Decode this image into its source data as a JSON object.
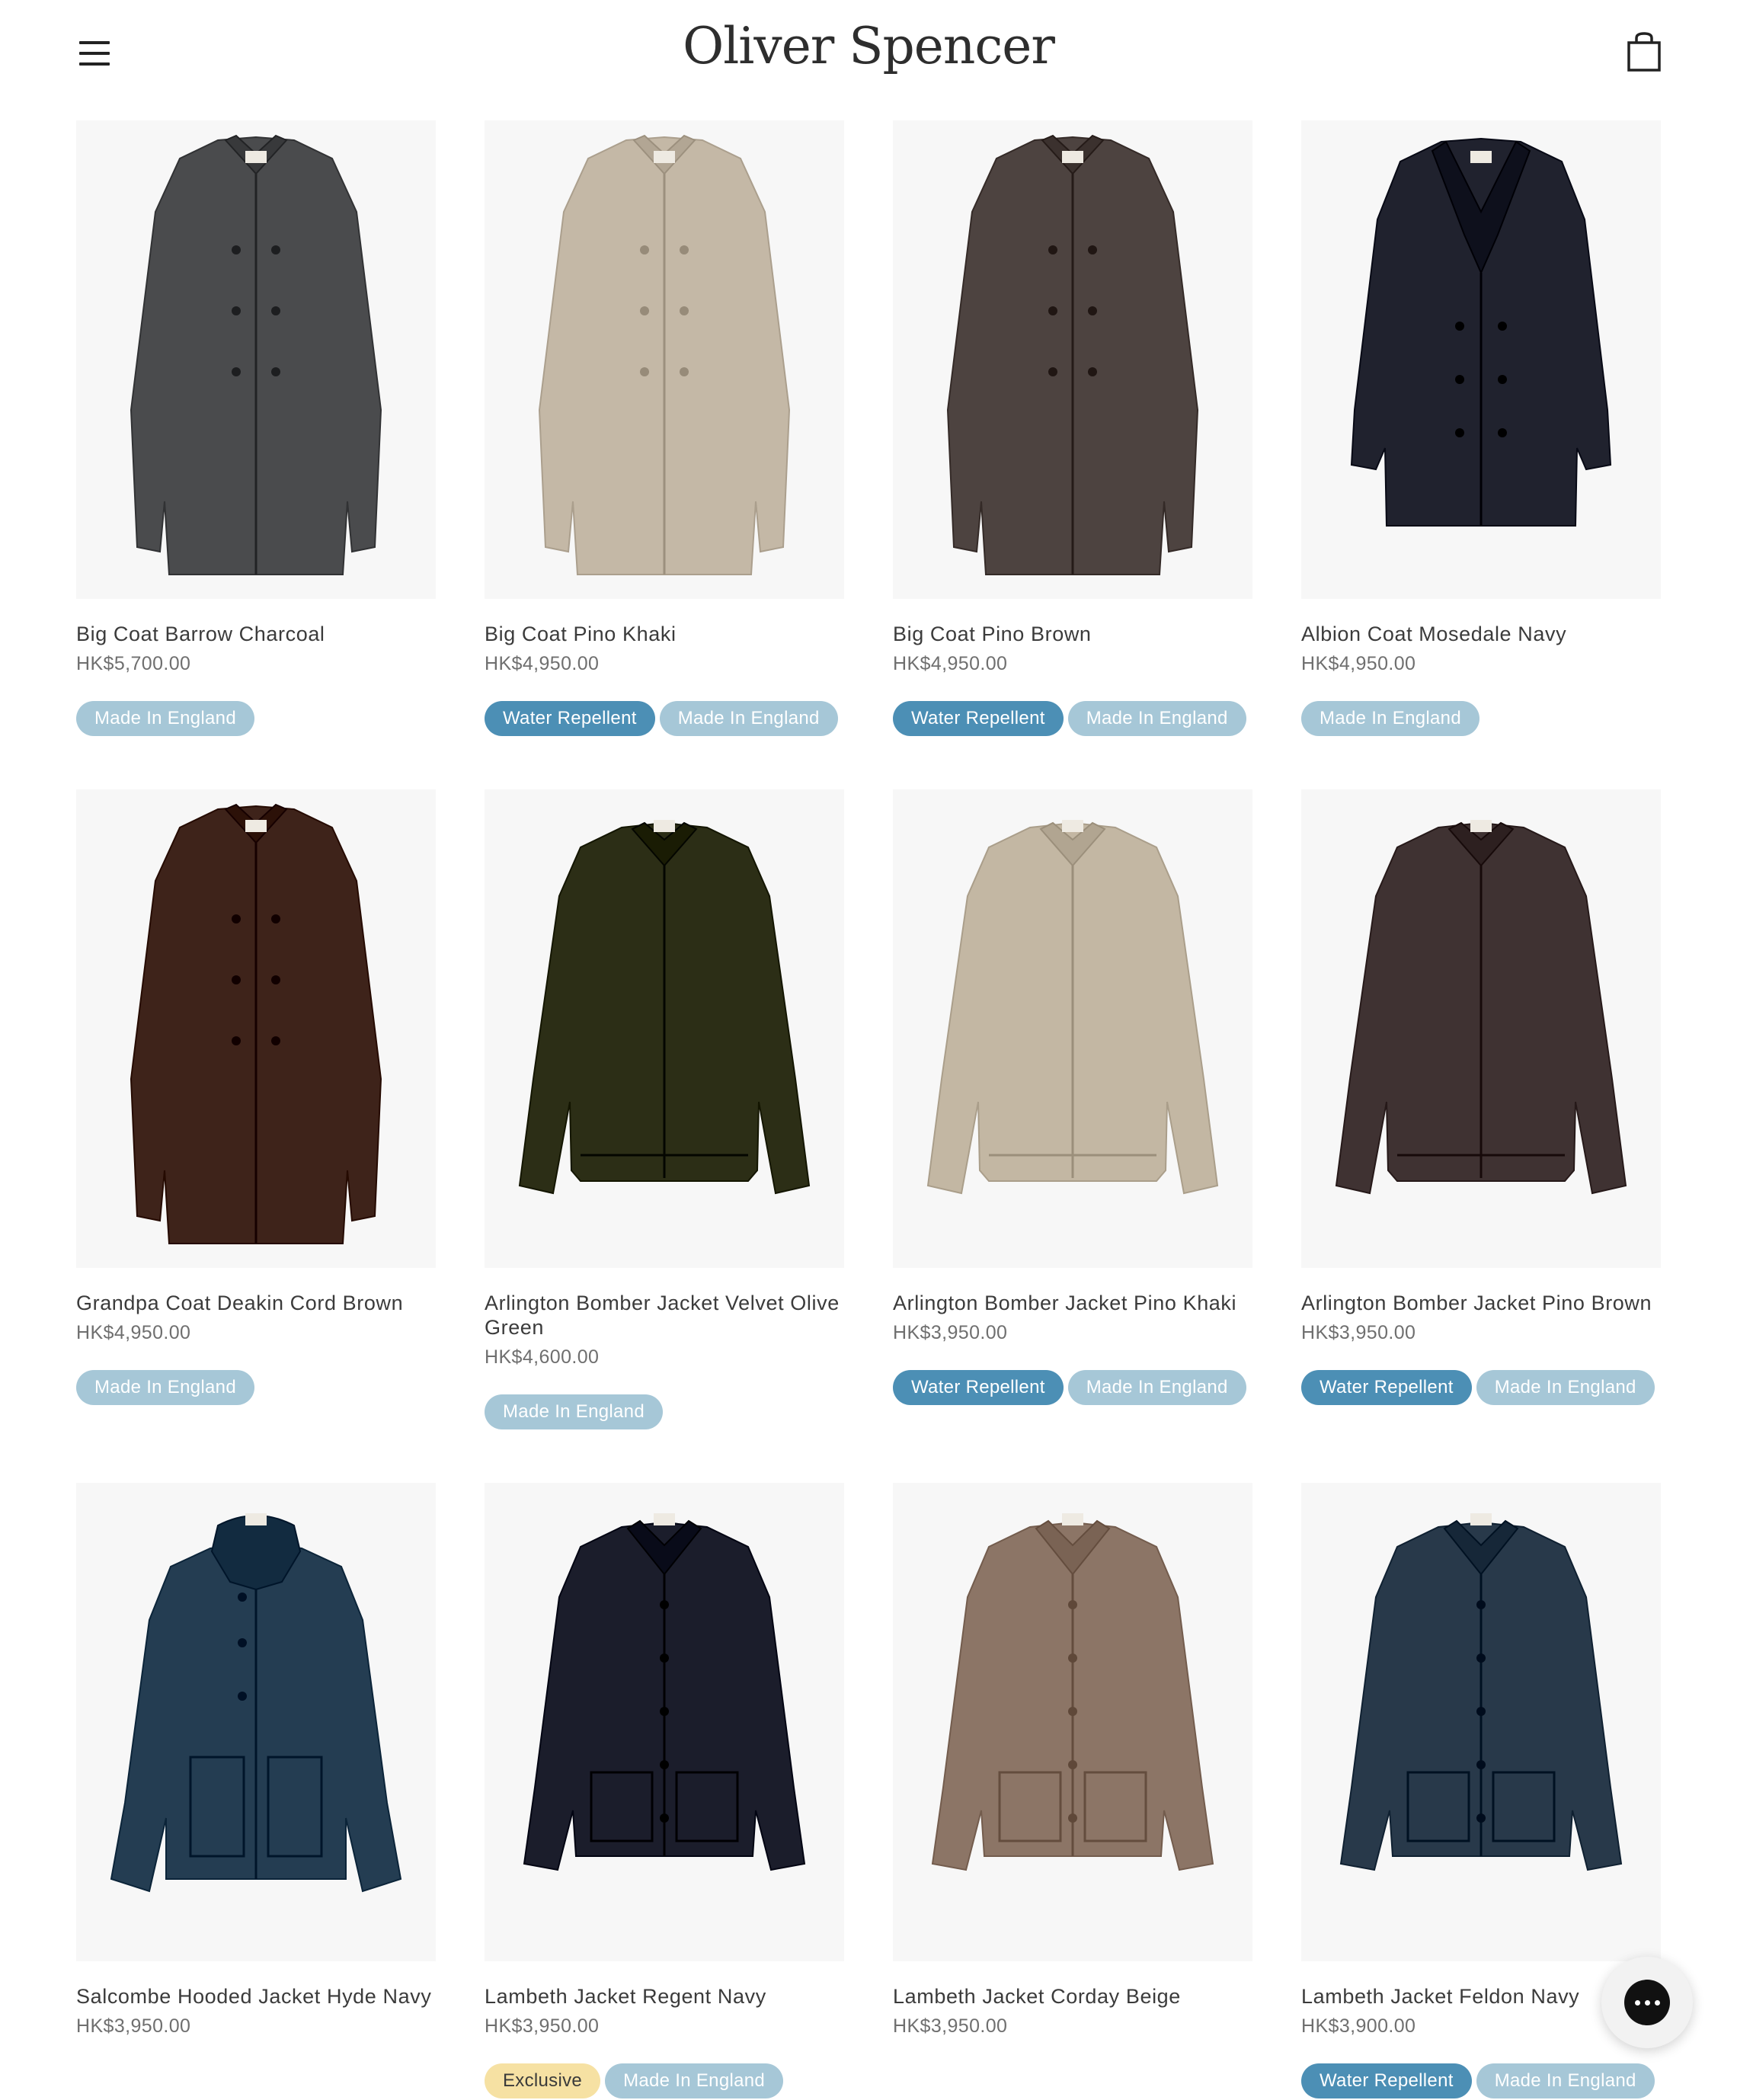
{
  "header": {
    "brand": "Oliver Spencer",
    "menu_icon": "hamburger-menu-icon",
    "cart_icon": "shopping-bag-icon"
  },
  "colors": {
    "water_badge": "#4c8fb5",
    "made_badge": "#a6c7d7",
    "exclusive_badge": "#f6e1a3",
    "image_bg": "#f7f7f7"
  },
  "products": [
    {
      "title": "Big Coat Barrow Charcoal",
      "price": "HK$5,700.00",
      "badges": [
        {
          "label": "Made In England",
          "kind": "made"
        }
      ],
      "garment": "long-coat",
      "color": "#4a4b4d"
    },
    {
      "title": "Big Coat Pino Khaki",
      "price": "HK$4,950.00",
      "badges": [
        {
          "label": "Water Repellent",
          "kind": "water"
        },
        {
          "label": "Made In England",
          "kind": "made"
        }
      ],
      "garment": "long-coat",
      "color": "#c4b8a6"
    },
    {
      "title": "Big Coat Pino Brown",
      "price": "HK$4,950.00",
      "badges": [
        {
          "label": "Water Repellent",
          "kind": "water"
        },
        {
          "label": "Made In England",
          "kind": "made"
        }
      ],
      "garment": "long-coat",
      "color": "#4d4340"
    },
    {
      "title": "Albion Coat Mosedale Navy",
      "price": "HK$4,950.00",
      "badges": [
        {
          "label": "Made In England",
          "kind": "made"
        }
      ],
      "garment": "peacoat",
      "color": "#20222e"
    },
    {
      "title": "Grandpa Coat Deakin Cord Brown",
      "price": "HK$4,950.00",
      "badges": [
        {
          "label": "Made In England",
          "kind": "made"
        }
      ],
      "garment": "long-coat",
      "color": "#3e231a"
    },
    {
      "title": "Arlington Bomber Jacket Velvet Olive Green",
      "price": "HK$4,600.00",
      "badges": [
        {
          "label": "Made In England",
          "kind": "made"
        }
      ],
      "garment": "bomber",
      "color": "#2c2e16"
    },
    {
      "title": "Arlington Bomber Jacket Pino Khaki",
      "price": "HK$3,950.00",
      "badges": [
        {
          "label": "Water Repellent",
          "kind": "water"
        },
        {
          "label": "Made In England",
          "kind": "made"
        }
      ],
      "garment": "bomber",
      "color": "#c3b7a3"
    },
    {
      "title": "Arlington Bomber Jacket Pino Brown",
      "price": "HK$3,950.00",
      "badges": [
        {
          "label": "Water Repellent",
          "kind": "water"
        },
        {
          "label": "Made In England",
          "kind": "made"
        }
      ],
      "garment": "bomber",
      "color": "#3f3232"
    },
    {
      "title": "Salcombe Hooded Jacket Hyde Navy",
      "price": "HK$3,950.00",
      "badges": [],
      "garment": "hooded",
      "color": "#243d52"
    },
    {
      "title": "Lambeth Jacket Regent Navy",
      "price": "HK$3,950.00",
      "badges": [
        {
          "label": "Exclusive",
          "kind": "excl"
        },
        {
          "label": "Made In England",
          "kind": "made"
        }
      ],
      "garment": "chore",
      "color": "#1b1d2b"
    },
    {
      "title": "Lambeth Jacket Corday Beige",
      "price": "HK$3,950.00",
      "badges": [],
      "garment": "chore",
      "color": "#8c7566"
    },
    {
      "title": "Lambeth Jacket Feldon Navy",
      "price": "HK$3,900.00",
      "badges": [
        {
          "label": "Water Repellent",
          "kind": "water"
        },
        {
          "label": "Made In England",
          "kind": "made"
        }
      ],
      "garment": "chore",
      "color": "#28394a"
    }
  ],
  "chat": {
    "icon": "chat-bubble-icon"
  }
}
